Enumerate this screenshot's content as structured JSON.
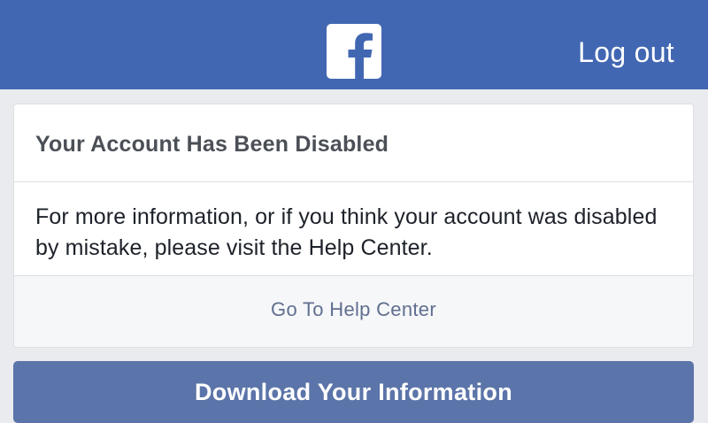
{
  "header": {
    "logo_icon": "facebook-f-icon",
    "logout_label": "Log out",
    "background_color": "#4267b2"
  },
  "notice": {
    "title": "Your Account Has Been Disabled",
    "message": "For more information, or if you think your account was disabled by mistake, please visit the Help Center.",
    "help_link_label": "Go To Help Center"
  },
  "actions": {
    "download_label": "Download Your Information",
    "button_color": "#5b74a9"
  }
}
